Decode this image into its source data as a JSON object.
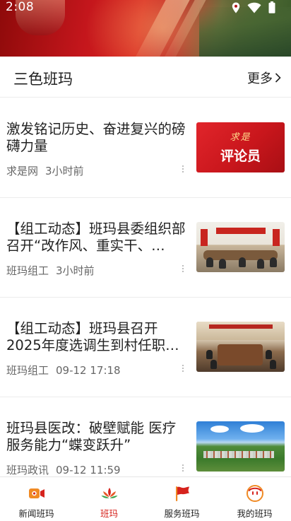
{
  "status_bar": {
    "time": "2:08",
    "icons": [
      "location-icon",
      "wifi-icon",
      "battery-icon"
    ]
  },
  "section": {
    "title": "三色班玛",
    "more_label": "更多",
    "more_icon": "chevron-right-icon"
  },
  "news": [
    {
      "title": "激发铭记历史、奋进复兴的磅礴力量",
      "source": "求是网",
      "time": "3小时前",
      "thumb_brand": "求是",
      "thumb_label": "评论员"
    },
    {
      "title": "【组工动态】班玛县委组织部召开“改作风、重实干、…",
      "source": "班玛组工",
      "time": "3小时前"
    },
    {
      "title": "【组工动态】班玛县召开2025年度选调生到村任职…",
      "source": "班玛组工",
      "time": "09-12  17:18"
    },
    {
      "title": "班玛县医改：破壁赋能  医疗服务能力“蝶变跃升”",
      "source": "班玛政讯",
      "time": "09-12  11:59"
    }
  ],
  "bottom_nav": [
    {
      "label": "新闻班玛",
      "icon": "video-camera-icon",
      "active": false
    },
    {
      "label": "班玛",
      "icon": "lotus-icon",
      "active": true
    },
    {
      "label": "服务班玛",
      "icon": "flag-icon",
      "active": false
    },
    {
      "label": "我的班玛",
      "icon": "smiley-icon",
      "active": false
    }
  ],
  "colors": {
    "accent": "#d6231d",
    "nav_icon_orange": "#f08a24"
  }
}
